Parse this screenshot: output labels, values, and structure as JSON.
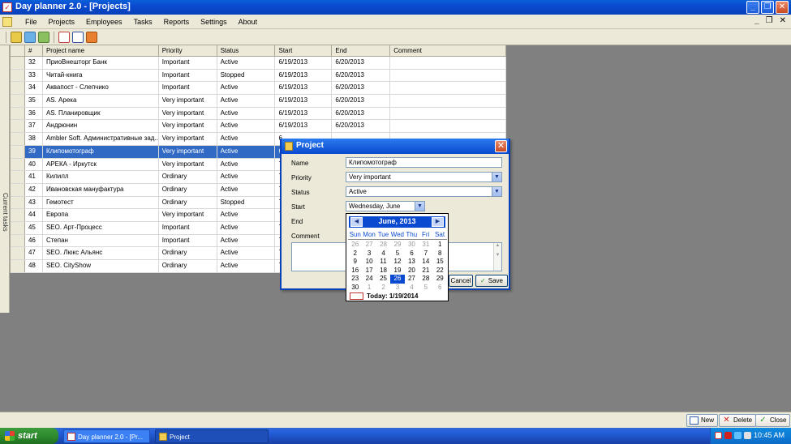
{
  "window": {
    "title": "Day planner 2.0 - [Projects]"
  },
  "menu": {
    "items": [
      "File",
      "Projects",
      "Employees",
      "Tasks",
      "Reports",
      "Settings",
      "About"
    ]
  },
  "sidebar": {
    "tab_label": "Current tasks"
  },
  "grid": {
    "columns": [
      "#",
      "Project name",
      "Priority",
      "Status",
      "Start",
      "End",
      "Comment"
    ],
    "rows": [
      {
        "num": "32",
        "name": "ПриоВнешторг Банк",
        "priority": "Important",
        "status": "Active",
        "start": "6/19/2013",
        "end": "6/20/2013",
        "comment": ""
      },
      {
        "num": "33",
        "name": "Читай-книга",
        "priority": "Important",
        "status": "Stopped",
        "start": "6/19/2013",
        "end": "6/20/2013",
        "comment": ""
      },
      {
        "num": "34",
        "name": "Аквапост - Слепчико",
        "priority": "Important",
        "status": "Active",
        "start": "6/19/2013",
        "end": "6/20/2013",
        "comment": ""
      },
      {
        "num": "35",
        "name": "AS. Арека",
        "priority": "Very important",
        "status": "Active",
        "start": "6/19/2013",
        "end": "6/20/2013",
        "comment": ""
      },
      {
        "num": "36",
        "name": "AS. Планировщик",
        "priority": "Very important",
        "status": "Active",
        "start": "6/19/2013",
        "end": "6/20/2013",
        "comment": ""
      },
      {
        "num": "37",
        "name": "Андрюнин",
        "priority": "Very important",
        "status": "Active",
        "start": "6/19/2013",
        "end": "6/20/2013",
        "comment": ""
      },
      {
        "num": "38",
        "name": "Ambler Soft. Административные зад...",
        "priority": "Very important",
        "status": "Active",
        "start": "6",
        "end": "",
        "comment": ""
      },
      {
        "num": "39",
        "name": "Клипомотограф",
        "priority": "Very important",
        "status": "Active",
        "start": "6",
        "end": "",
        "comment": ""
      },
      {
        "num": "40",
        "name": "АРЕКА - Иркутск",
        "priority": "Very important",
        "status": "Active",
        "start": "7",
        "end": "",
        "comment": ""
      },
      {
        "num": "41",
        "name": "Килилл",
        "priority": "Ordinary",
        "status": "Active",
        "start": "7",
        "end": "",
        "comment": ""
      },
      {
        "num": "42",
        "name": "Ивановская мануфактура",
        "priority": "Ordinary",
        "status": "Active",
        "start": "7",
        "end": "",
        "comment": ""
      },
      {
        "num": "43",
        "name": "Гемотест",
        "priority": "Ordinary",
        "status": "Stopped",
        "start": "7",
        "end": "",
        "comment": ""
      },
      {
        "num": "44",
        "name": "Европа",
        "priority": "Very important",
        "status": "Active",
        "start": "7",
        "end": "",
        "comment": ""
      },
      {
        "num": "45",
        "name": "SEO. Арт-Процесс",
        "priority": "Important",
        "status": "Active",
        "start": "7",
        "end": "",
        "comment": ""
      },
      {
        "num": "46",
        "name": "Степан",
        "priority": "Important",
        "status": "Active",
        "start": "7",
        "end": "",
        "comment": ""
      },
      {
        "num": "47",
        "name": "SEO. Люкс Альянс",
        "priority": "Ordinary",
        "status": "Active",
        "start": "7",
        "end": "",
        "comment": ""
      },
      {
        "num": "48",
        "name": "SEO. CityShow",
        "priority": "Ordinary",
        "status": "Active",
        "start": "7",
        "end": "",
        "comment": ""
      }
    ],
    "selected_index": 7
  },
  "dialog": {
    "title": "Project",
    "name_label": "Name",
    "name_value": "Клипомотограф",
    "priority_label": "Priority",
    "priority_value": "Very important",
    "status_label": "Status",
    "status_value": "Active",
    "start_label": "Start",
    "start_value": "Wednesday,     June",
    "end_label": "End",
    "comment_label": "Comment",
    "cancel_label": "Cancel",
    "save_label": "Save"
  },
  "calendar": {
    "title": "June, 2013",
    "days_of_week": [
      "Sun",
      "Mon",
      "Tue",
      "Wed",
      "Thu",
      "Fri",
      "Sat"
    ],
    "days": [
      "26",
      "27",
      "28",
      "29",
      "30",
      "31",
      "1",
      "2",
      "3",
      "4",
      "5",
      "6",
      "7",
      "8",
      "9",
      "10",
      "11",
      "12",
      "13",
      "14",
      "15",
      "16",
      "17",
      "18",
      "19",
      "20",
      "21",
      "22",
      "23",
      "24",
      "25",
      "26",
      "27",
      "28",
      "29",
      "30",
      "1",
      "2",
      "3",
      "4",
      "5",
      "6"
    ],
    "dim_indices": [
      0,
      1,
      2,
      3,
      4,
      5,
      36,
      37,
      38,
      39,
      40,
      41
    ],
    "selected_index": 31,
    "today_label": "Today: 1/19/2014"
  },
  "bottom_toolbar": {
    "new_label": "New",
    "delete_label": "Delete",
    "close_label": "Close"
  },
  "taskbar": {
    "start_label": "start",
    "tasks": [
      "Day planner 2.0 - [Pr...",
      "Project"
    ],
    "clock": "10:45 AM"
  }
}
